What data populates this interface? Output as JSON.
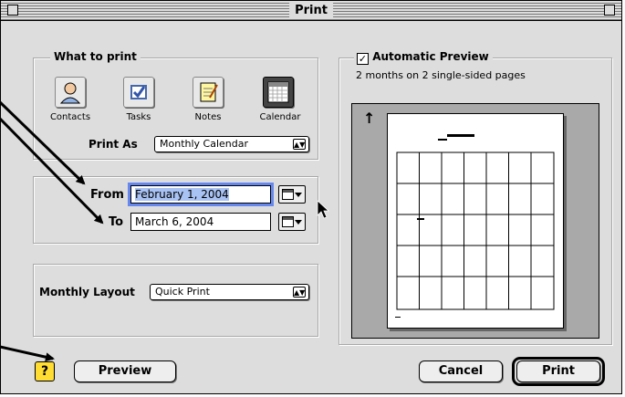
{
  "window": {
    "title": "Print"
  },
  "what_to_print": {
    "label": "What to print",
    "items": [
      {
        "label": "Contacts",
        "icon": "contacts-icon",
        "selected": false
      },
      {
        "label": "Tasks",
        "icon": "tasks-icon",
        "selected": false
      },
      {
        "label": "Notes",
        "icon": "notes-icon",
        "selected": false
      },
      {
        "label": "Calendar",
        "icon": "calendar-icon",
        "selected": true
      }
    ],
    "print_as_label": "Print As",
    "print_as_value": "Monthly Calendar"
  },
  "date_range": {
    "from_label": "From",
    "from_value": "February 1, 2004",
    "to_label": "To",
    "to_value": "March 6, 2004"
  },
  "layout": {
    "label": "Monthly Layout",
    "value": "Quick Print"
  },
  "preview": {
    "checkbox_label": "Automatic Preview",
    "checked": true,
    "description": "2 months on 2 single-sided pages"
  },
  "buttons": {
    "help": "?",
    "preview": "Preview",
    "cancel": "Cancel",
    "print": "Print"
  }
}
